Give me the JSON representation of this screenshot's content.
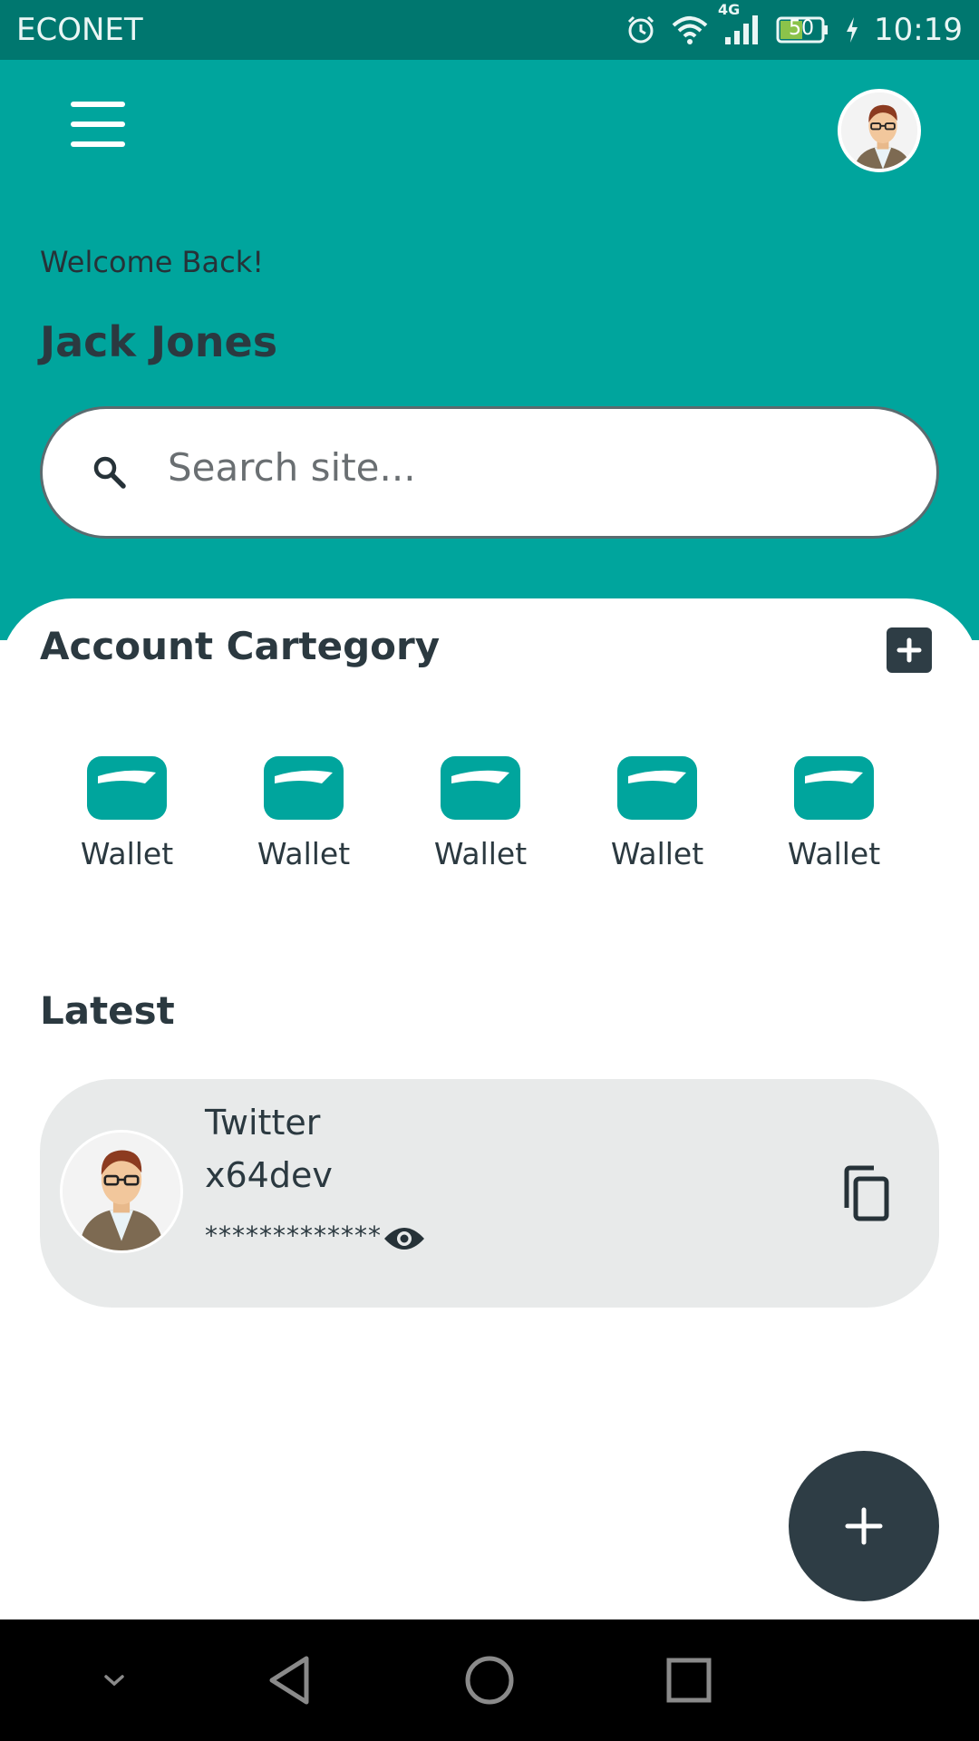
{
  "status_bar": {
    "carrier": "ECONET",
    "network": "4G",
    "battery": "50",
    "time": "10:19"
  },
  "header": {
    "welcome": "Welcome Back!",
    "username": "Jack Jones",
    "search_placeholder": "Search site..."
  },
  "account_category": {
    "title": "Account Cartegory",
    "items": [
      {
        "label": "Wallet",
        "icon": "wallet-icon"
      },
      {
        "label": "Wallet",
        "icon": "wallet-icon"
      },
      {
        "label": "Wallet",
        "icon": "wallet-icon"
      },
      {
        "label": "Wallet",
        "icon": "wallet-icon"
      },
      {
        "label": "Wallet",
        "icon": "wallet-icon"
      }
    ]
  },
  "latest": {
    "title": "Latest",
    "entry": {
      "service": "Twitter",
      "username": "x64dev",
      "password_masked": "*************"
    }
  },
  "colors": {
    "primary": "#00a59d",
    "status_bar": "#00776f",
    "dark": "#2e3d45",
    "card": "#e8eaea"
  }
}
